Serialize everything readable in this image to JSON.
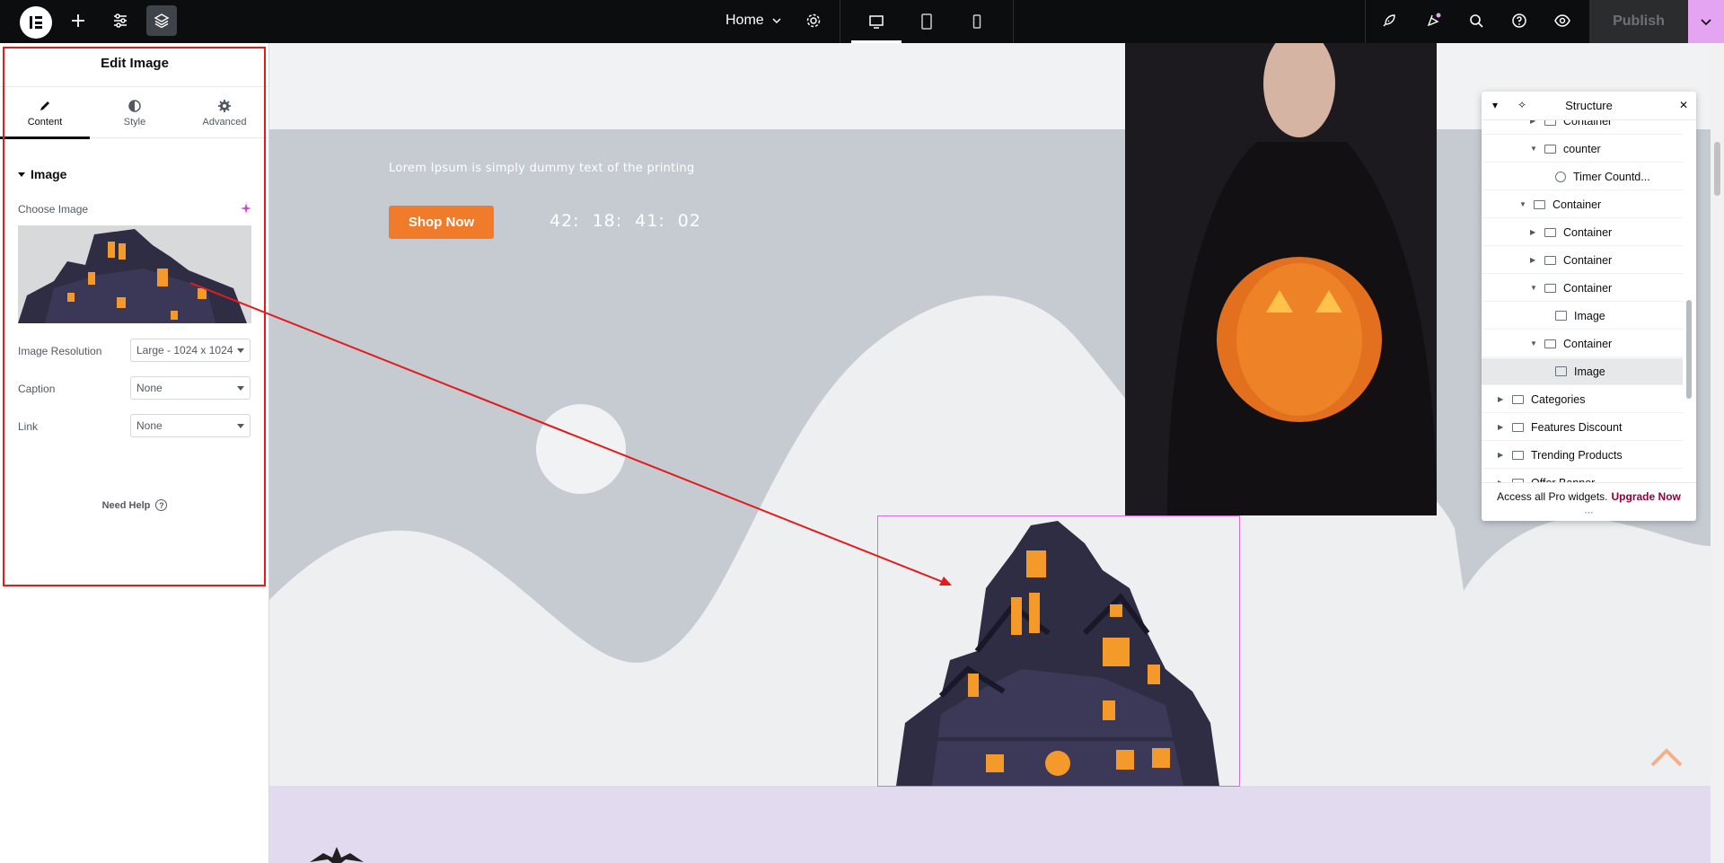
{
  "topbar": {
    "page_name": "Home",
    "publish_label": "Publish"
  },
  "panel": {
    "title": "Edit Image",
    "tabs": [
      {
        "label": "Content",
        "icon": "pencil-icon"
      },
      {
        "label": "Style",
        "icon": "half-circle-icon"
      },
      {
        "label": "Advanced",
        "icon": "gear-icon"
      }
    ],
    "section_title": "Image",
    "choose_image_label": "Choose Image",
    "image_resolution_label": "Image Resolution",
    "image_resolution_value": "Large - 1024 x 1024",
    "caption_label": "Caption",
    "caption_value": "None",
    "link_label": "Link",
    "link_value": "None",
    "need_help": "Need Help"
  },
  "canvas": {
    "hero_text": "Lorem Ipsum is simply dummy text of the printing",
    "shop_button": "Shop Now",
    "timer": [
      "42:",
      "18:",
      "41:",
      "02"
    ]
  },
  "structure": {
    "title": "Structure",
    "items": [
      {
        "label": "Container",
        "indent": 4,
        "caret": "right",
        "kind": "box"
      },
      {
        "label": "counter",
        "indent": 4,
        "caret": "down",
        "kind": "box"
      },
      {
        "label": "Timer Countd...",
        "indent": 5,
        "caret": "",
        "kind": "clock"
      },
      {
        "label": "Container",
        "indent": 3,
        "caret": "down",
        "kind": "box"
      },
      {
        "label": "Container",
        "indent": 4,
        "caret": "right",
        "kind": "box"
      },
      {
        "label": "Container",
        "indent": 4,
        "caret": "right",
        "kind": "box"
      },
      {
        "label": "Container",
        "indent": 4,
        "caret": "down",
        "kind": "box"
      },
      {
        "label": "Image",
        "indent": 5,
        "caret": "",
        "kind": "img"
      },
      {
        "label": "Container",
        "indent": 4,
        "caret": "down",
        "kind": "box"
      },
      {
        "label": "Image",
        "indent": 5,
        "caret": "",
        "kind": "img",
        "selected": true
      },
      {
        "label": "Categories",
        "indent": 1,
        "caret": "right",
        "kind": "box"
      },
      {
        "label": "Features Discount",
        "indent": 1,
        "caret": "right",
        "kind": "box"
      },
      {
        "label": "Trending Products",
        "indent": 1,
        "caret": "right",
        "kind": "box"
      },
      {
        "label": "Offer Banner",
        "indent": 1,
        "caret": "right",
        "kind": "box"
      }
    ],
    "promo_text": "Access all Pro widgets.",
    "upgrade_label": "Upgrade Now"
  },
  "colors": {
    "accent_orange": "#f07b2b",
    "highlight_red": "#e21b1b",
    "selection_pink": "#d36cf0",
    "upgrade": "#93003f"
  }
}
